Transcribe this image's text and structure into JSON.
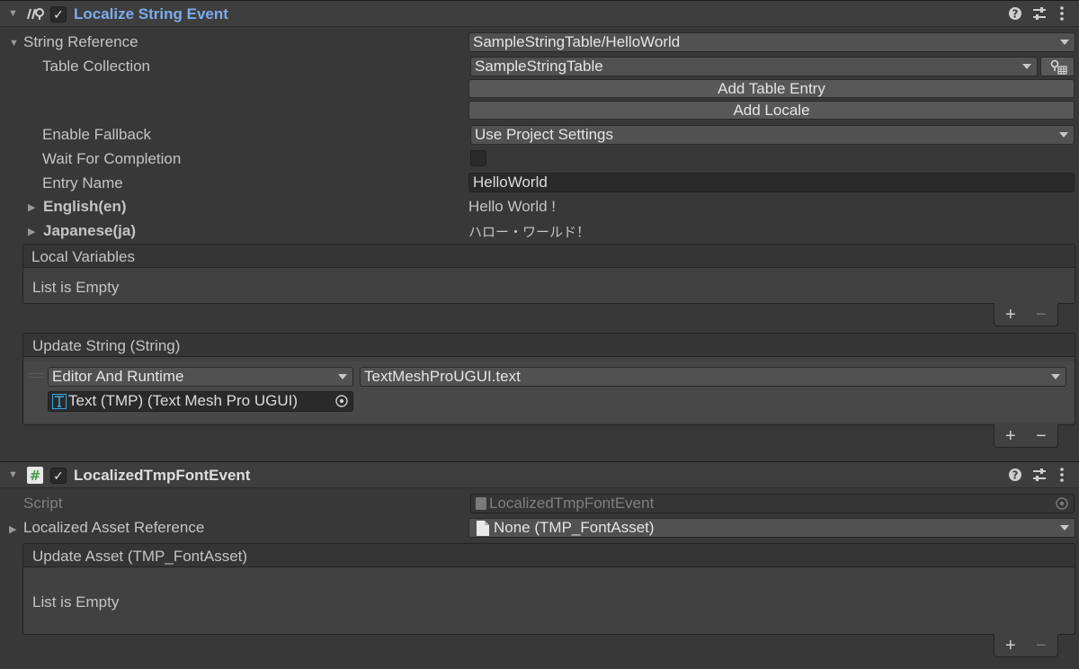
{
  "component1": {
    "title": "Localize String Event",
    "enabled_mark": "✓",
    "string_reference": {
      "label": "String Reference",
      "value": "SampleStringTable/HelloWorld"
    },
    "table_collection": {
      "label": "Table Collection",
      "value": "SampleStringTable"
    },
    "add_table_entry": "Add Table Entry",
    "add_locale": "Add Locale",
    "enable_fallback": {
      "label": "Enable Fallback",
      "value": "Use Project Settings"
    },
    "wait_for_completion": {
      "label": "Wait For Completion",
      "checked": false
    },
    "entry_name": {
      "label": "Entry Name",
      "value": "HelloWorld"
    },
    "locales": [
      {
        "label": "English(en)",
        "value": "Hello World !"
      },
      {
        "label": "Japanese(ja)",
        "value": "ハロー・ワールド！"
      }
    ],
    "local_variables": {
      "header": "Local Variables",
      "empty_text": "List is Empty"
    },
    "update_string": {
      "header": "Update String (String)",
      "runtime_mode": "Editor And Runtime",
      "function": "TextMeshProUGUI.text",
      "target_object": "Text (TMP) (Text Mesh Pro UGUI)"
    },
    "plus": "+",
    "minus": "−"
  },
  "component2": {
    "title": "LocalizedTmpFontEvent",
    "enabled_mark": "✓",
    "script": {
      "label": "Script",
      "value": "LocalizedTmpFontEvent"
    },
    "asset_reference": {
      "label": "Localized Asset Reference",
      "value": "None (TMP_FontAsset)"
    },
    "update_asset": {
      "header": "Update Asset (TMP_FontAsset)",
      "empty_text": "List is Empty"
    },
    "plus": "+",
    "minus": "−"
  },
  "colors": {
    "component1_title": "#7cacec",
    "component2_title": "#dedede",
    "script_icon": "#4d9a4d"
  },
  "icons": [
    "localize-icon",
    "script-icon",
    "help-icon",
    "presets-icon",
    "kebab-menu-icon",
    "table-picker-icon",
    "object-picker-icon",
    "document-icon",
    "tmp-text-icon"
  ]
}
